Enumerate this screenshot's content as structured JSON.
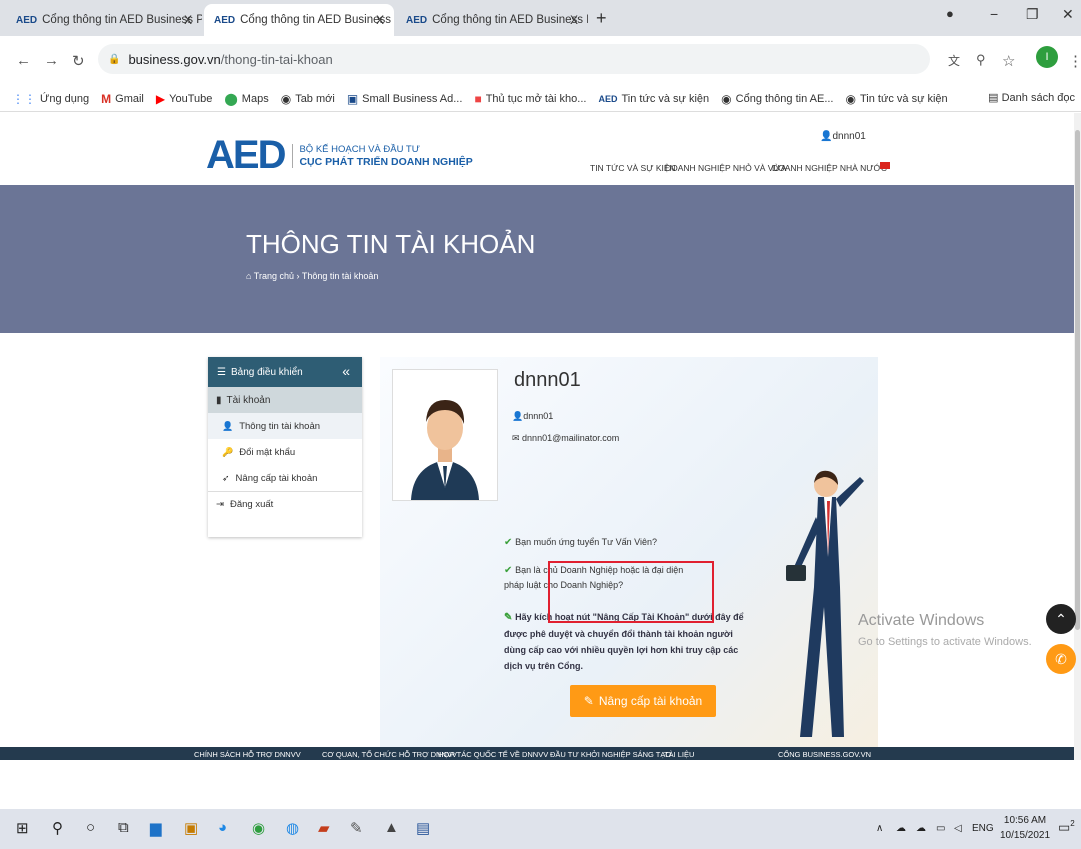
{
  "browser": {
    "tabs": [
      {
        "favicon": "AED",
        "title": "Cổng thông tin AED Business Por",
        "close": "X"
      },
      {
        "favicon": "AED",
        "title": "Cổng thông tin AED Business Por",
        "close": "X"
      },
      {
        "favicon": "AED",
        "title": "Cổng thông tin AED Business Por",
        "close": "X"
      }
    ],
    "new_tab": "+",
    "url_domain": "business.gov.vn",
    "url_path": "/thong-tin-tai-khoan",
    "profile_initial": "I",
    "bookmarks": [
      {
        "icon": "apps-icon",
        "label": "Ứng dụng"
      },
      {
        "icon": "gmail-icon",
        "label": "Gmail"
      },
      {
        "icon": "youtube-icon",
        "label": "YouTube"
      },
      {
        "icon": "maps-icon",
        "label": "Maps"
      },
      {
        "icon": "globe-icon",
        "label": "Tab mới"
      },
      {
        "icon": "sba-icon",
        "label": "Small Business Ad..."
      },
      {
        "icon": "pdf-icon",
        "label": "Thủ tục mở tài kho..."
      },
      {
        "icon": "aed-icon",
        "label": "Tin tức và sự kiện"
      },
      {
        "icon": "globe-icon",
        "label": "Cổng thông tin AE..."
      },
      {
        "icon": "globe-icon",
        "label": "Tin tức và sự kiện"
      }
    ],
    "reading_list": "Danh sách đọc"
  },
  "site": {
    "logo_mark": "AED",
    "logo_line1": "BỘ KẾ HOẠCH VÀ ĐẦU TƯ",
    "logo_line2": "CỤC PHÁT TRIỂN DOANH NGHIỆP",
    "user": "dnnn01",
    "menu": [
      "TIN TỨC VÀ SỰ KIỆN",
      "DOANH NGHIỆP NHỎ VÀ VỪA",
      "DOANH NGHIỆP NHÀ NƯỚC"
    ],
    "page_title": "THÔNG TIN TÀI KHOẢN",
    "breadcrumb_home": "Trang chủ",
    "breadcrumb_sep": "›",
    "breadcrumb_current": "Thông tin tài khoản"
  },
  "sidebar": {
    "header": "Bảng điều khiển",
    "collapse": "«",
    "section": "Tài khoản",
    "items": [
      {
        "icon": "user-icon",
        "label": "Thông tin tài khoản"
      },
      {
        "icon": "key-icon",
        "label": "Đổi mật khẩu"
      },
      {
        "icon": "upgrade-icon",
        "label": "Nâng cấp tài khoản"
      }
    ],
    "logout": "Đăng xuất"
  },
  "profile": {
    "name": "dnnn01",
    "username": "dnnn01",
    "email": "dnnn01@mailinator.com",
    "line1": "Bạn muốn ứng tuyển Tư Vấn Viên?",
    "line2": "Bạn là chủ Doanh Nghiệp hoặc là đại diện pháp luật cho Doanh Nghiệp?",
    "line3": "Hãy kích hoạt nút \"Nâng Cấp Tài Khoản\" dưới đây để được phê duyệt và chuyển đổi thành tài khoản người dùng cấp cao với nhiều quyền lợi hơn khi truy cập các dịch vụ trên Cổng.",
    "upgrade_button": "Nâng cấp tài khoản"
  },
  "footer": {
    "links": [
      "CHÍNH SÁCH HỖ TRỢ DNNVV",
      "CƠ QUAN, TỔ CHỨC HỖ TRỢ DNNVV",
      "HỢP TÁC QUỐC TẾ VỀ DNNVV",
      "ĐẦU TƯ KHỞI NGHIỆP SÁNG TẠO",
      "TÀI LIỆU",
      "CỔNG BUSINESS.GOV.VN"
    ]
  },
  "overlay": {
    "activate_title": "Activate Windows",
    "activate_sub": "Go to Settings to activate Windows."
  },
  "taskbar": {
    "lang": "ENG",
    "time": "10:56 AM",
    "date": "10/15/2021",
    "notif_count": "2"
  },
  "colors": {
    "hero": "#6b7596",
    "sidebar_header": "#2e5d74",
    "upgrade_button": "#ff9a15",
    "highlight_box": "#e02030",
    "footer": "#243a4e"
  }
}
